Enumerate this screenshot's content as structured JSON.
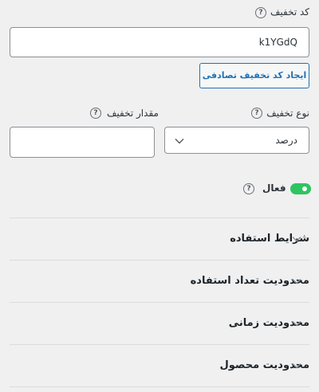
{
  "coupon_code": {
    "label": "کد تخفیف",
    "value": "k1YGdQ",
    "generate_button": "ایجاد کد تخفیف تصادفی"
  },
  "discount_type": {
    "label": "نوع تخفیف",
    "selected": "درصد"
  },
  "discount_amount": {
    "label": "مقدار تخفیف",
    "value": ""
  },
  "active": {
    "label": "فعال",
    "enabled": true
  },
  "sections": [
    {
      "title": "شرایط استفاده"
    },
    {
      "title": "محدودیت تعداد استفاده"
    },
    {
      "title": "محدودیت زمانی"
    },
    {
      "title": "محدودیت محصول"
    }
  ],
  "help_glyph": "?",
  "colors": {
    "accent": "#2271b1",
    "toggle_on": "#2dc560",
    "background": "#f0f0f1"
  }
}
